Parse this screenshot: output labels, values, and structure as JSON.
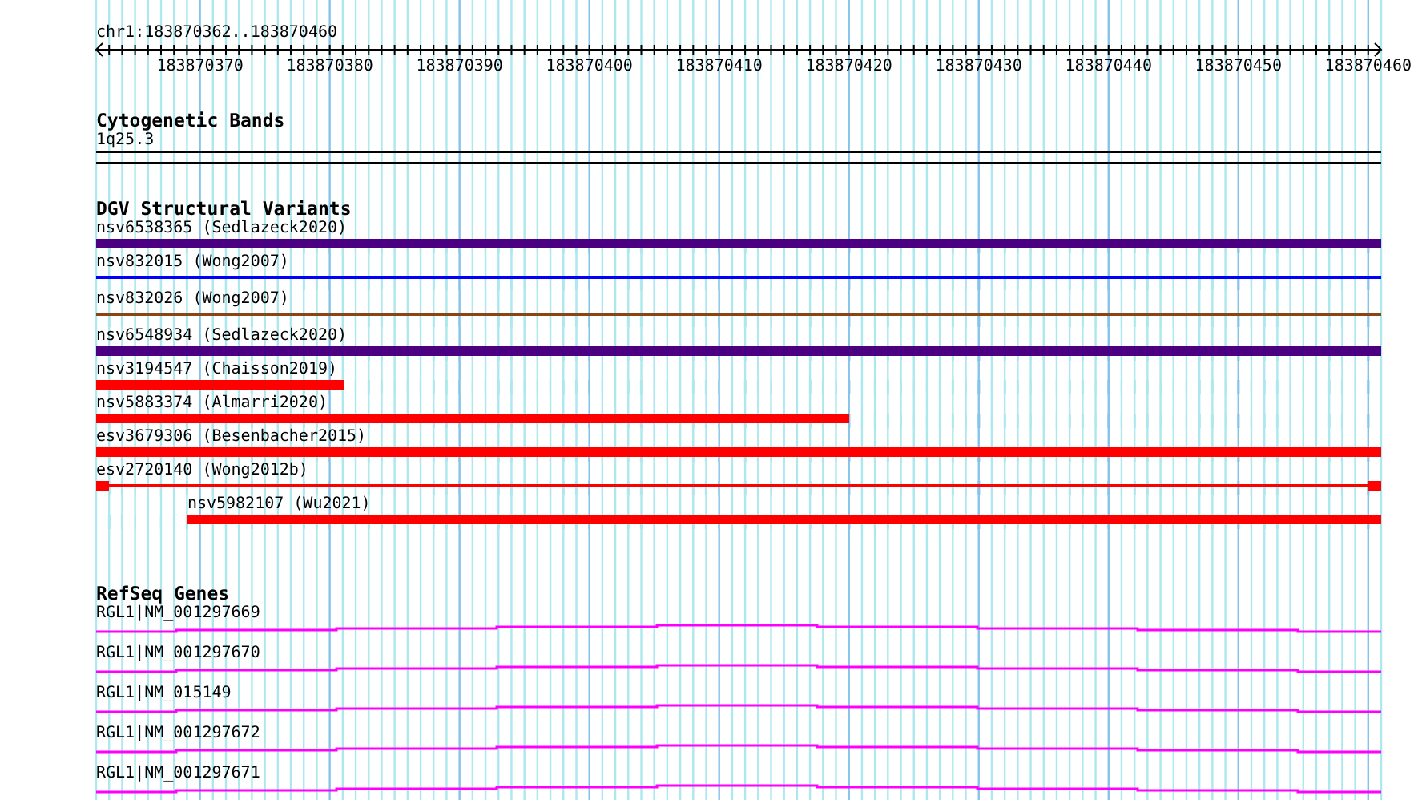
{
  "ruler": {
    "label": "chr1:183870362..183870460",
    "ticks": [
      "183870370",
      "183870380",
      "183870390",
      "183870400",
      "183870410",
      "183870420",
      "183870430",
      "183870440",
      "183870450",
      "183870460"
    ]
  },
  "cytogenetic_bands": {
    "title": "Cytogenetic Bands",
    "band": "1q25.3"
  },
  "dgv_structural_variants": {
    "title": "DGV Structural Variants",
    "features": [
      {
        "label": "nsv6538365 (Sedlazeck2020)",
        "kind": "thick",
        "color": "#4b0082",
        "level": 1
      },
      {
        "label": "nsv832015 (Wong2007)",
        "kind": "line",
        "color": "#0000ff",
        "level": 1
      },
      {
        "label": "nsv832026 (Wong2007)",
        "kind": "line",
        "color": "#8b4513",
        "level": 1
      },
      {
        "label": "nsv6548934 (Sedlazeck2020)",
        "kind": "thick",
        "color": "#4b0082",
        "level": 1
      },
      {
        "label": "nsv3194547 (Chaisson2019)",
        "kind": "thick",
        "color": "#ff0000",
        "level": 0.193
      },
      {
        "label": "nsv5883374 (Almarri2020)",
        "kind": "thick",
        "color": "#ff0000",
        "level": 0.586
      },
      {
        "label": "esv3679306 (Besenbacher2015)",
        "kind": "thick",
        "color": "#ff0000",
        "level": 1
      },
      {
        "label": "esv2720140 (Wong2012b)",
        "kind": "split",
        "color": "#ff0000",
        "level": 1
      },
      {
        "label": "nsv5982107 (Wu2021)",
        "kind": "thick-right",
        "color": "#ff0000",
        "level": 0.929
      }
    ]
  },
  "refseq_genes": {
    "title": "RefSeq Genes",
    "genes": [
      {
        "label": "RGL1|NM_001297669"
      },
      {
        "label": "RGL1|NM_001297670"
      },
      {
        "label": "RGL1|NM_015149"
      },
      {
        "label": "RGL1|NM_001297672"
      },
      {
        "label": "RGL1|NM_001297671"
      }
    ]
  }
}
